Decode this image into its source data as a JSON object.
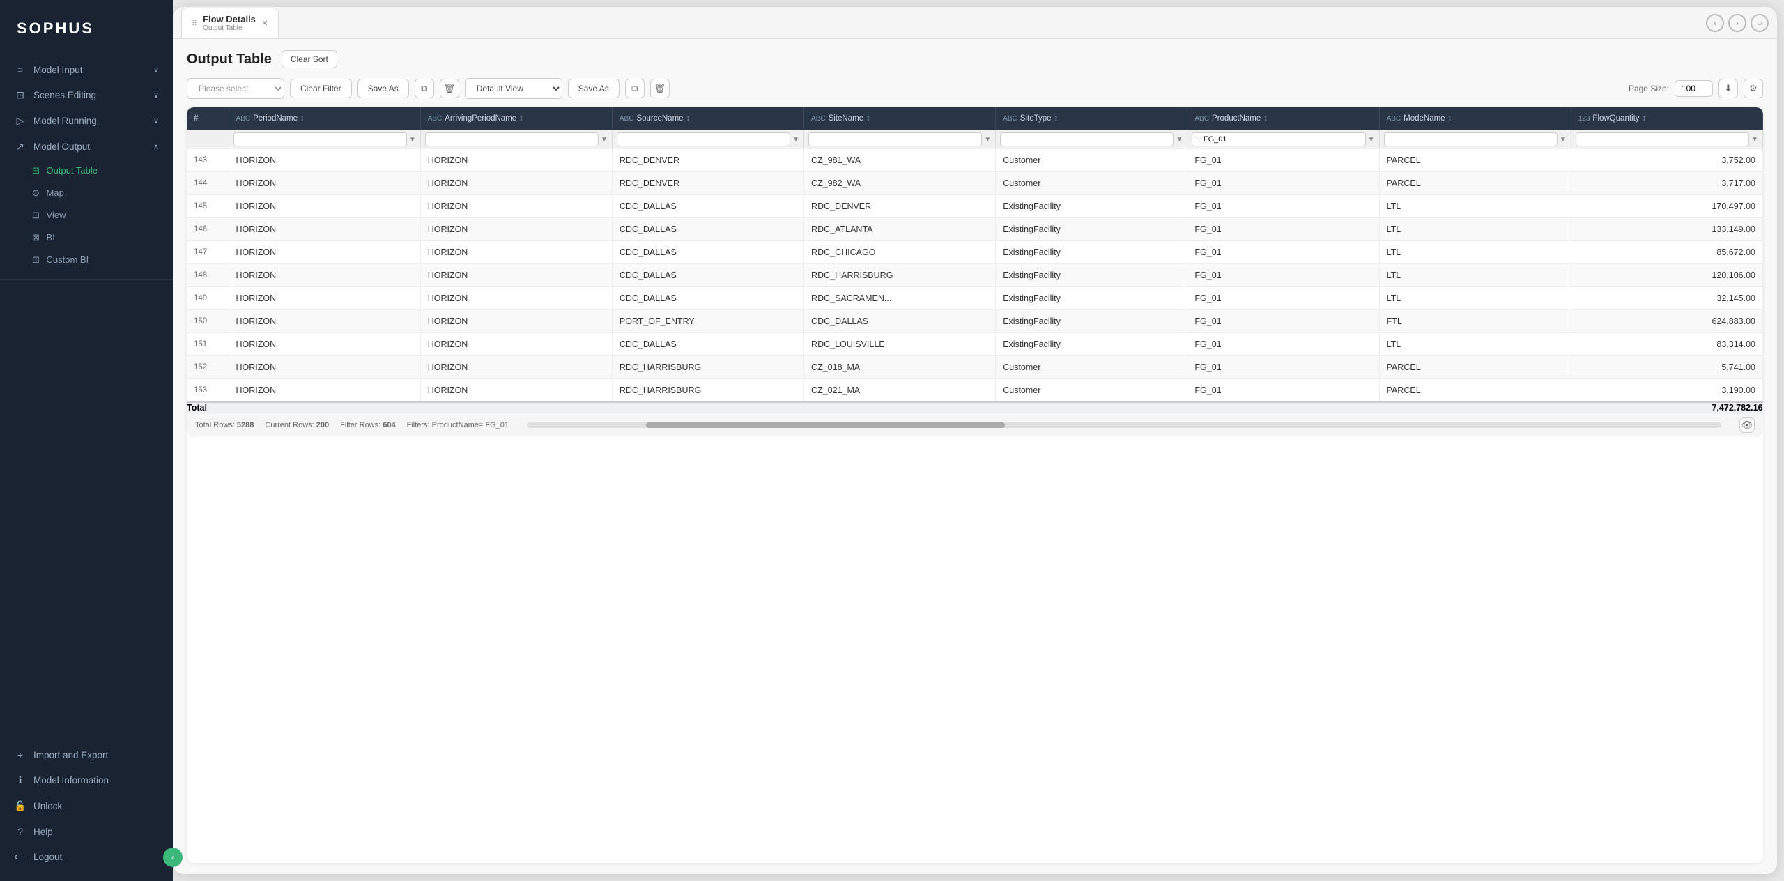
{
  "app": {
    "logo": "SOPHUS"
  },
  "sidebar": {
    "items": [
      {
        "id": "model-input",
        "label": "Model Input",
        "icon": "≡",
        "hasArrow": true,
        "active": false
      },
      {
        "id": "scenes-editing",
        "label": "Scenes Editing",
        "icon": "⊡",
        "hasArrow": true,
        "active": false
      },
      {
        "id": "model-running",
        "label": "Model Running",
        "icon": "▷",
        "hasArrow": true,
        "active": false
      },
      {
        "id": "model-output",
        "label": "Model Output",
        "icon": "↗",
        "hasArrow": true,
        "active": true
      }
    ],
    "model_output_children": [
      {
        "id": "output-table",
        "label": "Output Table",
        "active": true
      },
      {
        "id": "map",
        "label": "Map",
        "active": false
      },
      {
        "id": "view",
        "label": "View",
        "active": false
      },
      {
        "id": "bi",
        "label": "BI",
        "active": false
      },
      {
        "id": "custom-bi",
        "label": "Custom BI",
        "active": false
      }
    ],
    "bottom_items": [
      {
        "id": "import-export",
        "label": "Import and Export",
        "icon": "+"
      },
      {
        "id": "model-information",
        "label": "Model Information",
        "icon": "ℹ"
      },
      {
        "id": "unlock",
        "label": "Unlock",
        "icon": "🔓"
      },
      {
        "id": "help",
        "label": "Help",
        "icon": "?"
      },
      {
        "id": "logout",
        "label": "Logout",
        "icon": "⟵"
      }
    ]
  },
  "tab": {
    "title": "Flow Details",
    "subtitle": "Output Table"
  },
  "nav_arrows": [
    "‹",
    "›",
    "○"
  ],
  "content": {
    "page_title": "Output Table",
    "clear_sort_label": "Clear Sort",
    "filter": {
      "placeholder": "Please select",
      "clear_filter_label": "Clear Filter",
      "save_as_label": "Save As",
      "view_value": "Default View",
      "save_as2_label": "Save As"
    },
    "page_size_label": "Page Size:",
    "page_size_value": "100"
  },
  "table": {
    "columns": [
      {
        "id": "num",
        "label": "#",
        "type": ""
      },
      {
        "id": "period-name",
        "label": "PeriodName",
        "type": "ABC"
      },
      {
        "id": "arriving-period",
        "label": "ArrivingPeriodName",
        "type": "ABC"
      },
      {
        "id": "source-name",
        "label": "SourceName",
        "type": "ABC"
      },
      {
        "id": "site-name",
        "label": "SiteName",
        "type": "ABC"
      },
      {
        "id": "site-type",
        "label": "SiteType",
        "type": "ABC"
      },
      {
        "id": "product-name",
        "label": "ProductName",
        "type": "ABC"
      },
      {
        "id": "mode-name",
        "label": "ModeName",
        "type": "ABC"
      },
      {
        "id": "flow-quantity",
        "label": "FlowQuantity",
        "type": "123"
      }
    ],
    "filter_values": [
      "",
      "",
      "",
      "",
      "",
      "+ FG_01",
      "",
      ""
    ],
    "rows": [
      {
        "num": "143",
        "period": "HORIZON",
        "arriving": "HORIZON",
        "source": "RDC_DENVER",
        "site": "CZ_981_WA",
        "type": "Customer",
        "product": "FG_01",
        "mode": "PARCEL",
        "qty": "3,752.00"
      },
      {
        "num": "144",
        "period": "HORIZON",
        "arriving": "HORIZON",
        "source": "RDC_DENVER",
        "site": "CZ_982_WA",
        "type": "Customer",
        "product": "FG_01",
        "mode": "PARCEL",
        "qty": "3,717.00"
      },
      {
        "num": "145",
        "period": "HORIZON",
        "arriving": "HORIZON",
        "source": "CDC_DALLAS",
        "site": "RDC_DENVER",
        "type": "ExistingFacility",
        "product": "FG_01",
        "mode": "LTL",
        "qty": "170,497.00"
      },
      {
        "num": "146",
        "period": "HORIZON",
        "arriving": "HORIZON",
        "source": "CDC_DALLAS",
        "site": "RDC_ATLANTA",
        "type": "ExistingFacility",
        "product": "FG_01",
        "mode": "LTL",
        "qty": "133,149.00"
      },
      {
        "num": "147",
        "period": "HORIZON",
        "arriving": "HORIZON",
        "source": "CDC_DALLAS",
        "site": "RDC_CHICAGO",
        "type": "ExistingFacility",
        "product": "FG_01",
        "mode": "LTL",
        "qty": "85,672.00"
      },
      {
        "num": "148",
        "period": "HORIZON",
        "arriving": "HORIZON",
        "source": "CDC_DALLAS",
        "site": "RDC_HARRISBURG",
        "type": "ExistingFacility",
        "product": "FG_01",
        "mode": "LTL",
        "qty": "120,106.00"
      },
      {
        "num": "149",
        "period": "HORIZON",
        "arriving": "HORIZON",
        "source": "CDC_DALLAS",
        "site": "RDC_SACRAMEN...",
        "type": "ExistingFacility",
        "product": "FG_01",
        "mode": "LTL",
        "qty": "32,145.00"
      },
      {
        "num": "150",
        "period": "HORIZON",
        "arriving": "HORIZON",
        "source": "PORT_OF_ENTRY",
        "site": "CDC_DALLAS",
        "type": "ExistingFacility",
        "product": "FG_01",
        "mode": "FTL",
        "qty": "624,883.00"
      },
      {
        "num": "151",
        "period": "HORIZON",
        "arriving": "HORIZON",
        "source": "CDC_DALLAS",
        "site": "RDC_LOUISVILLE",
        "type": "ExistingFacility",
        "product": "FG_01",
        "mode": "LTL",
        "qty": "83,314.00"
      },
      {
        "num": "152",
        "period": "HORIZON",
        "arriving": "HORIZON",
        "source": "RDC_HARRISBURG",
        "site": "CZ_018_MA",
        "type": "Customer",
        "product": "FG_01",
        "mode": "PARCEL",
        "qty": "5,741.00"
      },
      {
        "num": "153",
        "period": "HORIZON",
        "arriving": "HORIZON",
        "source": "RDC_HARRISBURG",
        "site": "CZ_021_MA",
        "type": "Customer",
        "product": "FG_01",
        "mode": "PARCEL",
        "qty": "3,190.00"
      }
    ],
    "total_label": "Total",
    "total_value": "7,472,782.16"
  },
  "footer": {
    "total_rows_label": "Total Rows:",
    "total_rows_value": "5288",
    "current_rows_label": "Current Rows:",
    "current_rows_value": "200",
    "filter_rows_label": "Filter Rows:",
    "filter_rows_value": "604",
    "filters_label": "Filters:",
    "filters_value": "ProductName= FG_01"
  }
}
